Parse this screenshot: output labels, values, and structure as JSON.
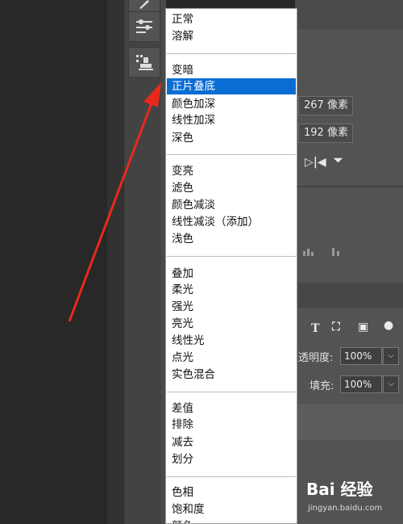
{
  "blend_menu": {
    "groups": [
      [
        {
          "label": "正常"
        },
        {
          "label": "溶解"
        }
      ],
      [
        {
          "label": "变暗"
        },
        {
          "label": "正片叠底",
          "selected": true
        },
        {
          "label": "颜色加深"
        },
        {
          "label": "线性加深"
        },
        {
          "label": "深色"
        }
      ],
      [
        {
          "label": "变亮"
        },
        {
          "label": "滤色"
        },
        {
          "label": "颜色减淡"
        },
        {
          "label": "线性减淡（添加）"
        },
        {
          "label": "浅色"
        }
      ],
      [
        {
          "label": "叠加"
        },
        {
          "label": "柔光"
        },
        {
          "label": "强光"
        },
        {
          "label": "亮光"
        },
        {
          "label": "线性光"
        },
        {
          "label": "点光"
        },
        {
          "label": "实色混合"
        }
      ],
      [
        {
          "label": "差值"
        },
        {
          "label": "排除"
        },
        {
          "label": "减去"
        },
        {
          "label": "划分"
        }
      ],
      [
        {
          "label": "色相"
        },
        {
          "label": "饱和度"
        },
        {
          "label": "颜色"
        }
      ]
    ]
  },
  "properties": {
    "width_value": "267 像素",
    "height_value": "192 像素"
  },
  "layers": {
    "opacity_label": "透明度:",
    "opacity_value": "100%",
    "fill_label": "填充:",
    "fill_value": "100%"
  },
  "watermark": {
    "brand": "Bai 经验",
    "url": "jingyan.baidu.com"
  },
  "colors": {
    "selection": "#0a6dd4",
    "annotation_arrow": "#e8291c"
  }
}
